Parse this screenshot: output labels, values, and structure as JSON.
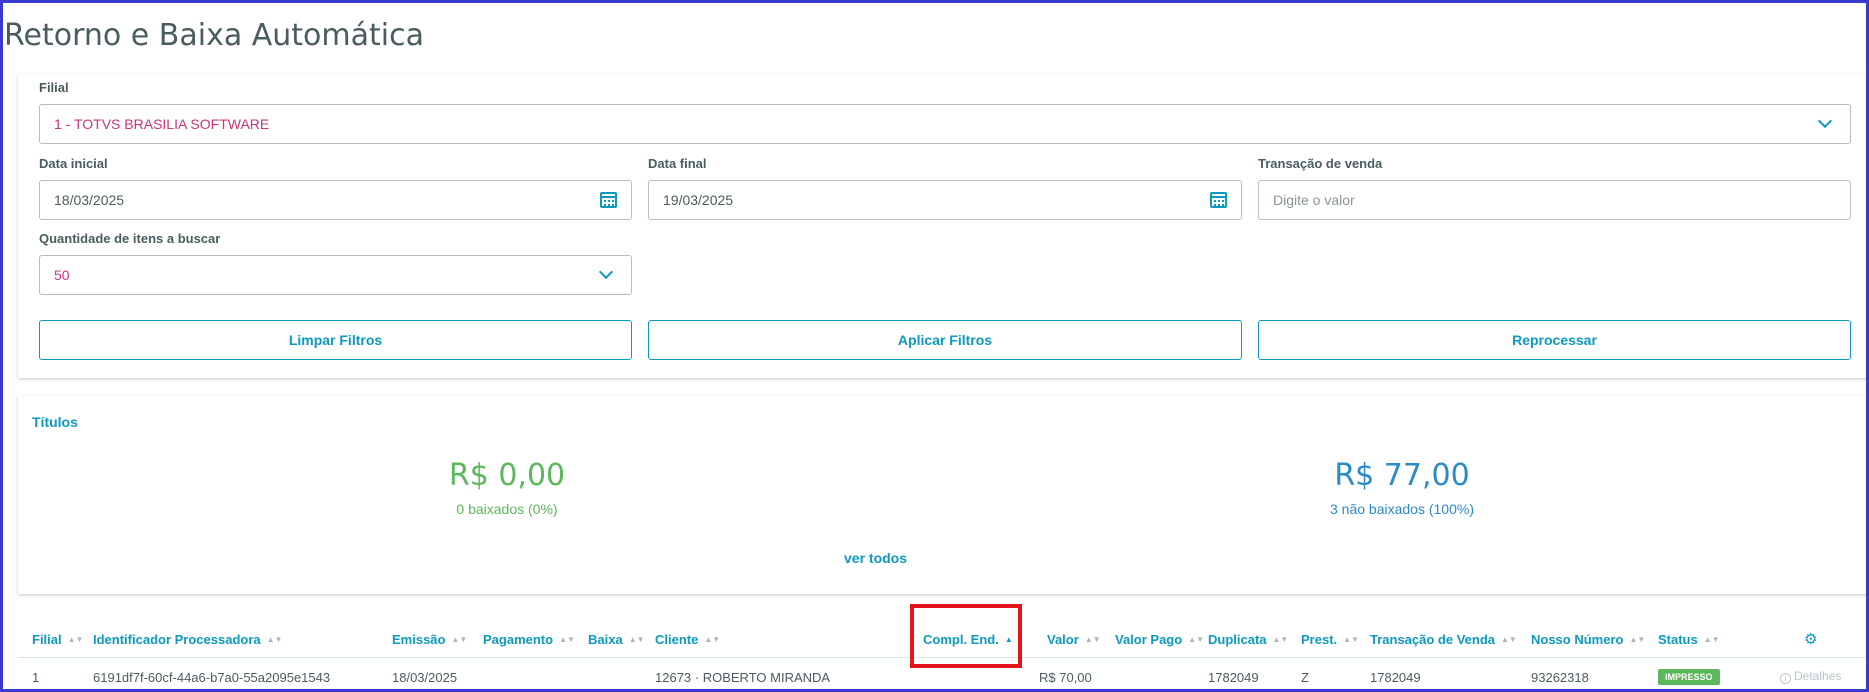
{
  "page": {
    "title": "Retorno e Baixa Automática"
  },
  "filters": {
    "filial": {
      "label": "Filial",
      "value": "1 - TOTVS BRASILIA SOFTWARE"
    },
    "data_inicial": {
      "label": "Data inicial",
      "value": "18/03/2025"
    },
    "data_final": {
      "label": "Data final",
      "value": "19/03/2025"
    },
    "transacao": {
      "label": "Transação de venda",
      "placeholder": "Digite o valor"
    },
    "quantidade": {
      "label": "Quantidade de itens a buscar",
      "value": "50"
    },
    "buttons": {
      "limpar": "Limpar Filtros",
      "aplicar": "Aplicar Filtros",
      "reprocessar": "Reprocessar"
    }
  },
  "titulos": {
    "title": "Títulos",
    "baixados": {
      "amount": "R$ 0,00",
      "caption": "0 baixados (0%)"
    },
    "nao_baixados": {
      "amount": "R$ 77,00",
      "caption": "3 não baixados (100%)"
    },
    "ver_todos": "ver todos"
  },
  "table": {
    "columns": {
      "filial": "Filial",
      "identificador": "Identificador Processadora",
      "emissao": "Emissão",
      "pagamento": "Pagamento",
      "baixa": "Baixa",
      "cliente": "Cliente",
      "compl_end": "Compl. End.",
      "valor": "Valor",
      "valor_pago": "Valor Pago",
      "duplicata": "Duplicata",
      "prest": "Prest.",
      "transacao": "Transação de Venda",
      "nosso_numero": "Nosso Número",
      "status": "Status"
    },
    "rows": [
      {
        "filial": "1",
        "identificador": "6191df7f-60cf-44a6-b7a0-55a2095e1543",
        "emissao": "18/03/2025",
        "cliente": "12673 · ROBERTO MIRANDA",
        "valor": "R$ 70,00",
        "duplicata": "1782049",
        "prest": "Z",
        "transacao": "1782049",
        "nosso_numero": "93262318",
        "status": "IMPRESSO",
        "detalhes": "Detalhes"
      }
    ],
    "sorted_column": "compl_end",
    "sort_direction": "asc"
  },
  "colors": {
    "accent": "#0c9abe",
    "success": "#5cb85c",
    "info": "#2b8ac8",
    "pink_value": "#c9357d",
    "highlight": "#e3141c"
  }
}
